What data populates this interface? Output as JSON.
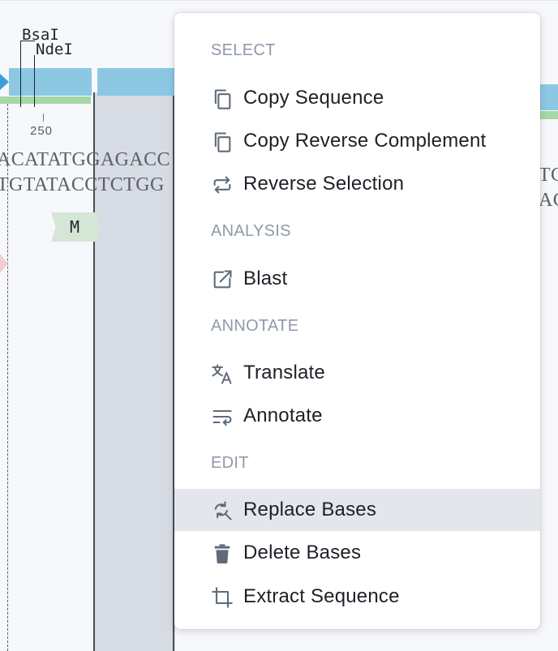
{
  "viewer": {
    "enzymes": [
      "BsaI",
      "NdeI"
    ],
    "ruler_label": "250",
    "seq_top": "ACATATGGAGACC",
    "seq_bottom": "TGTATACCTCTGG",
    "right_seq_top": "TC",
    "right_seq_bottom": "AC",
    "amino_acid": "M",
    "colors": {
      "feature_blue": "#8cc8e4",
      "feature_green": "#a6d8a8",
      "selection": "#d7dbe3",
      "marker_pink": "#f3cccc"
    }
  },
  "menu": {
    "sections": {
      "select": "SELECT",
      "analysis": "ANALYSIS",
      "annotate": "ANNOTATE",
      "edit": "EDIT"
    },
    "items": {
      "copy_sequence": {
        "label": "Copy Sequence",
        "icon": "copy-icon"
      },
      "copy_reverse_complement": {
        "label": "Copy Reverse Complement",
        "icon": "copy-icon"
      },
      "reverse_selection": {
        "label": "Reverse Selection",
        "icon": "swap-arrows-icon"
      },
      "blast": {
        "label": "Blast",
        "icon": "external-link-icon"
      },
      "translate": {
        "label": "Translate",
        "icon": "translate-icon"
      },
      "annotate": {
        "label": "Annotate",
        "icon": "wrap-lines-icon"
      },
      "replace_bases": {
        "label": "Replace Bases",
        "icon": "search-replace-icon",
        "highlighted": true
      },
      "delete_bases": {
        "label": "Delete Bases",
        "icon": "trash-icon"
      },
      "extract_sequence": {
        "label": "Extract Sequence",
        "icon": "crop-icon"
      }
    },
    "colors": {
      "header": "#8f99a8",
      "text": "#1c2127",
      "highlight": "#e3e6eb"
    }
  }
}
